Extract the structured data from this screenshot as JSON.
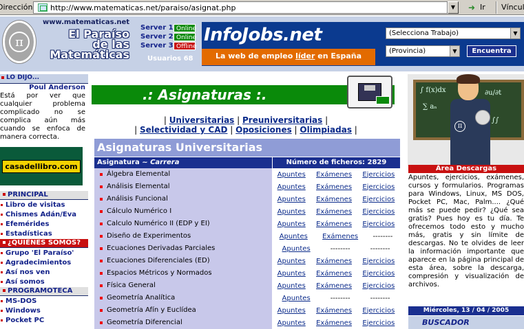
{
  "browser": {
    "address_label": "Dirección",
    "url": "http://www.matematicas.net/paraiso/asignat.php",
    "go_label": "Ir",
    "links_label": "Vínculos"
  },
  "header": {
    "site_url": "www.matematicas.net",
    "site_name_line1": "El Paraíso",
    "site_name_line2": "de las",
    "site_name_line3": "Matemáticas",
    "servers": [
      {
        "label": "Server 1",
        "status": "Online"
      },
      {
        "label": "Server 2",
        "status": "Online"
      },
      {
        "label": "Server 3",
        "status": "Offline"
      }
    ],
    "users_text": "Usuarios 68"
  },
  "banner": {
    "brand": "InfoJobs",
    "brand_suffix": ".net",
    "tagline_pre": "La web de empleo ",
    "tagline_u": "líder",
    "tagline_post": " en España",
    "select_trabajo": "(Selecciona Trabajo)",
    "select_provincia": "(Provincia)",
    "search_button": "Encuentra"
  },
  "sidebar": {
    "quote_head": "LO DIJO...",
    "quote_author": "Poul Anderson",
    "quote_text": "Está por ver que cualquier problema complicado no se complica aún más cuando se enfoca de manera correcta.",
    "casa_logo": "casadellibro.com",
    "sections": [
      {
        "head": "PRINCIPAL",
        "red": false,
        "items": [
          "Libro de visitas",
          "Chismes Adán/Eva",
          "Efemérides",
          "Estadísticas"
        ]
      },
      {
        "head": "¿QUIÉNES SOMOS?",
        "red": true,
        "items": [
          "Grupo 'El Paraíso'",
          "Agradecimientos",
          "Así nos ven",
          "Así somos"
        ]
      },
      {
        "head": "PROGRAMOTECA",
        "red": false,
        "items": [
          "MS-DOS",
          "Windows",
          "Pocket PC"
        ]
      }
    ]
  },
  "main": {
    "title": ".: Asignaturas :.",
    "nav": {
      "universitarias": "Universitarias",
      "preuniversitarias": "Preuniversitarias",
      "selectividad": "Selectividad y CAD",
      "oposiciones": "Oposiciones",
      "olimpiadas": "Olimpiadas"
    },
    "section_title": "Asignaturas Universitarias",
    "table": {
      "col1_a": "Asignatura ~ ",
      "col1_b": "Carrera",
      "col2": "Número de ficheros: 2829",
      "rows": [
        {
          "name": "Álgebra Elemental",
          "apuntes": "Apuntes",
          "examenes": "Exámenes",
          "ejercicios": "Ejercicios"
        },
        {
          "name": "Análisis Elemental",
          "apuntes": "Apuntes",
          "examenes": "Exámenes",
          "ejercicios": "Ejercicios"
        },
        {
          "name": "Análisis Funcional",
          "apuntes": "Apuntes",
          "examenes": "Exámenes",
          "ejercicios": "Ejercicios"
        },
        {
          "name": "Cálculo Numérico I",
          "apuntes": "Apuntes",
          "examenes": "Exámenes",
          "ejercicios": "Ejercicios"
        },
        {
          "name": "Calculo Numérico II (EDP y EI)",
          "apuntes": "Apuntes",
          "examenes": "Exámenes",
          "ejercicios": "Ejercicios"
        },
        {
          "name": "Diseño de Experimentos",
          "apuntes": "Apuntes",
          "examenes": "Exámenes",
          "ejercicios": "--------"
        },
        {
          "name": "Ecuaciones Derivadas Parciales",
          "apuntes": "Apuntes",
          "examenes": "--------",
          "ejercicios": "--------"
        },
        {
          "name": "Ecuaciones Diferenciales (ED)",
          "apuntes": "Apuntes",
          "examenes": "Exámenes",
          "ejercicios": "Ejercicios"
        },
        {
          "name": "Espacios Métricos y Normados",
          "apuntes": "Apuntes",
          "examenes": "Exámenes",
          "ejercicios": "Ejercicios"
        },
        {
          "name": "Física General",
          "apuntes": "Apuntes",
          "examenes": "Exámenes",
          "ejercicios": "Ejercicios"
        },
        {
          "name": "Geometría Analítica",
          "apuntes": "Apuntes",
          "examenes": "--------",
          "ejercicios": "--------"
        },
        {
          "name": "Geometría Afín y Euclídea",
          "apuntes": "Apuntes",
          "examenes": "Exámenes",
          "ejercicios": "Ejercicios"
        },
        {
          "name": "Geometría Diferencial",
          "apuntes": "Apuntes",
          "examenes": "Exámenes",
          "ejercicios": "Ejercicios"
        }
      ]
    }
  },
  "right": {
    "area_title": "Área Descargas",
    "area_text": "Apuntes, ejercicios, exámenes, cursos y formularios. Programas para Windows, Linux, MS DOS, Pocket PC, Mac, Palm.... ¿Qué más se puede pedir? ¿Qué sea gratis? Pues hoy es tu día. Te ofrecemos todo esto y mucho más, gratis y sin límite de descargas. No te olvides de leer la información importante que aparece en la página principal de esta área, sobre la descarga, compresión y visualización de archivos.",
    "date": "Miércoles, 13 / 04 / 2005",
    "buscador": "BUSCADOR"
  },
  "colors": {
    "navy": "#1a2f8f",
    "green": "#0a8a0a",
    "red": "#c81010",
    "orange": "#e36b00"
  }
}
